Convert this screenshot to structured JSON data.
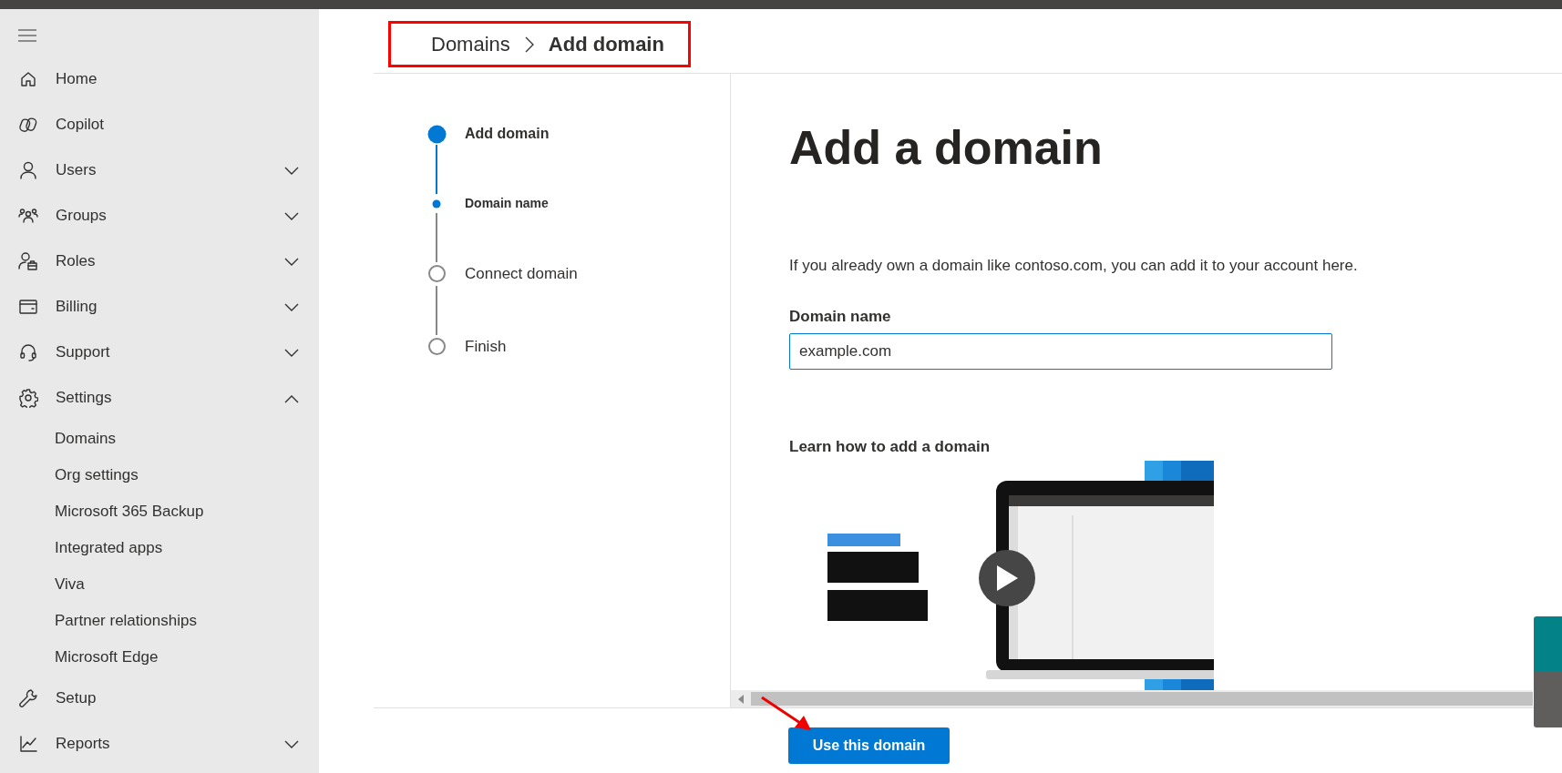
{
  "sidebar": {
    "items": [
      {
        "label": "Home"
      },
      {
        "label": "Copilot"
      },
      {
        "label": "Users",
        "expanded": false
      },
      {
        "label": "Groups",
        "expanded": false
      },
      {
        "label": "Roles",
        "expanded": false
      },
      {
        "label": "Billing",
        "expanded": false
      },
      {
        "label": "Support",
        "expanded": false
      },
      {
        "label": "Settings",
        "expanded": true,
        "children": [
          {
            "label": "Domains"
          },
          {
            "label": "Org settings"
          },
          {
            "label": "Microsoft 365 Backup"
          },
          {
            "label": "Integrated apps"
          },
          {
            "label": "Viva"
          },
          {
            "label": "Partner relationships"
          },
          {
            "label": "Microsoft Edge"
          }
        ]
      },
      {
        "label": "Setup"
      },
      {
        "label": "Reports",
        "expanded": false
      }
    ]
  },
  "breadcrumb": [
    {
      "label": "Domains",
      "current": false
    },
    {
      "label": "Add domain",
      "current": true
    }
  ],
  "steps": [
    {
      "label": "Add domain",
      "kind": "step",
      "selected": true
    },
    {
      "label": "Domain name",
      "kind": "substep",
      "selected": true
    },
    {
      "label": "Connect domain",
      "kind": "step",
      "selected": false
    },
    {
      "label": "Finish",
      "kind": "step",
      "selected": false
    }
  ],
  "content": {
    "heading": "Add a domain",
    "intro": "If you already own a domain like contoso.com, you can add it to your account here.",
    "field": {
      "label": "Domain name",
      "value": "example.com"
    },
    "video": {
      "title": "Learn how to add a domain",
      "kind": "picture"
    }
  },
  "footer": {
    "button": "Use this domain"
  }
}
